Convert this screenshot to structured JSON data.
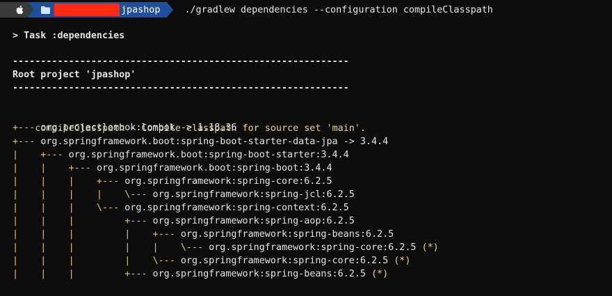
{
  "prompt": {
    "os_icon": "apple-icon",
    "folder_icon": "folder-icon",
    "directory": "jpashop",
    "command": "./gradlew dependencies --configuration compileClasspath"
  },
  "task_line": "> Task :dependencies",
  "rule": "------------------------------------------------------------",
  "root_project": "Root project 'jpashop'",
  "classpath": {
    "name": "compileClasspath",
    "description": " - Compile classpath for source set 'main'."
  },
  "deps": [
    {
      "prefix": "+--- ",
      "text": "org.projectlombok:lombok -> 1.18.36",
      "star": ""
    },
    {
      "prefix": "+--- ",
      "text": "org.springframework.boot:spring-boot-starter-data-jpa -> 3.4.4",
      "star": ""
    },
    {
      "prefix": "|    +--- ",
      "text": "org.springframework.boot:spring-boot-starter:3.4.4",
      "star": ""
    },
    {
      "prefix": "|    |    +--- ",
      "text": "org.springframework.boot:spring-boot:3.4.4",
      "star": ""
    },
    {
      "prefix": "|    |    |    +--- ",
      "text": "org.springframework:spring-core:6.2.5",
      "star": ""
    },
    {
      "prefix": "|    |    |    |    \\--- ",
      "text": "org.springframework:spring-jcl:6.2.5",
      "star": ""
    },
    {
      "prefix": "|    |    |    \\--- ",
      "text": "org.springframework:spring-context:6.2.5",
      "star": ""
    },
    {
      "prefix": "|    |    |         +--- ",
      "text": "org.springframework:spring-aop:6.2.5",
      "star": ""
    },
    {
      "prefix": "|    |    |         |    +--- ",
      "text": "org.springframework:spring-beans:6.2.5",
      "star": ""
    },
    {
      "prefix": "|    |    |         |    |    \\--- ",
      "text": "org.springframework:spring-core:6.2.5",
      "star": " (*)"
    },
    {
      "prefix": "|    |    |         |    \\--- ",
      "text": "org.springframework:spring-core:6.2.5",
      "star": " (*)"
    },
    {
      "prefix": "|    |    |         +--- ",
      "text": "org.springframework:spring-beans:6.2.5",
      "star": " (*)"
    }
  ],
  "colors": {
    "background": "#0d0d0d",
    "tree": "#e8c27a",
    "classpath_name": "#b6d47b",
    "description": "#f0d28a",
    "prompt_dir_bg": "#1f4f9a",
    "prompt_os_bg": "#3a3a3a"
  }
}
